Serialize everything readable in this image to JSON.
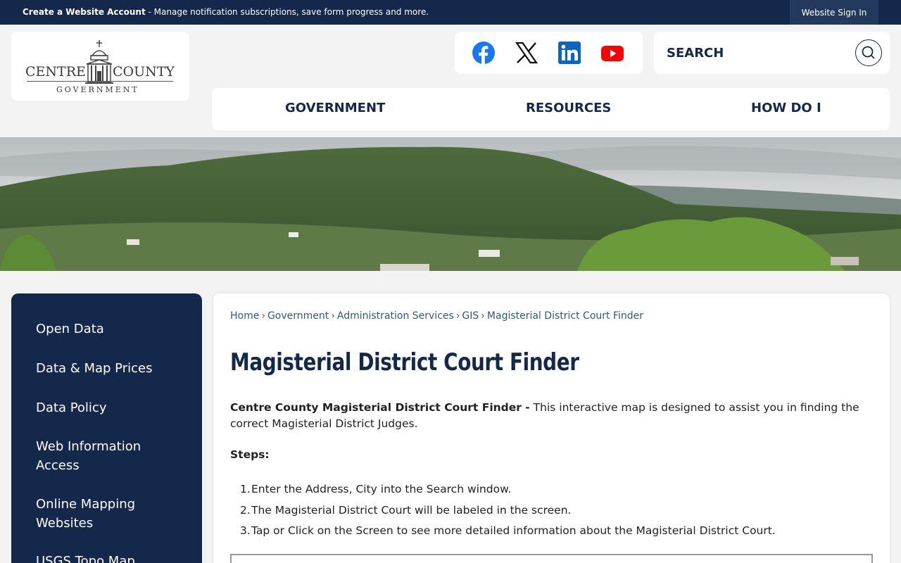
{
  "topbar": {
    "create_label": "Create a Website Account",
    "create_text": " - Manage notification subscriptions, save form progress and more.",
    "signin_label": "Website Sign In"
  },
  "logo": {
    "left_text": "CENTRE",
    "right_text": "COUNTY",
    "sub_text": "GOVERNMENT"
  },
  "social": {
    "facebook_icon": "facebook-icon",
    "x_icon": "x-icon",
    "linkedin_icon": "linkedin-icon",
    "youtube_icon": "youtube-icon"
  },
  "search": {
    "placeholder": "SEARCH",
    "icon": "search-icon"
  },
  "nav": {
    "items": [
      "GOVERNMENT",
      "RESOURCES",
      "HOW DO I"
    ]
  },
  "sidebar": {
    "items": [
      "Open Data",
      "Data & Map Prices",
      "Data Policy",
      "Web Information Access",
      "Online Mapping Websites",
      "USGS Topo Map"
    ]
  },
  "breadcrumb": {
    "items": [
      "Home",
      "Government",
      "Administration Services",
      "GIS",
      "Magisterial District Court Finder"
    ],
    "separator": "›"
  },
  "page": {
    "title": "Magisterial District Court Finder",
    "intro_bold": "Centre County Magisterial District Court Finder -",
    "intro_text": " This interactive map is designed to assist you in finding the correct Magisterial District Judges.",
    "steps_heading": "Steps:",
    "steps": [
      "Enter the Address, City into the Search window.",
      "The Magisterial District Court will be labeled in the screen.",
      "Tap or Click on the Screen to see more detailed information about the Magisterial District Court."
    ]
  },
  "colors": {
    "navy": "#13284a",
    "link": "#2e5a7a",
    "facebook": "#1877f2",
    "linkedin": "#0a66c2",
    "youtube": "#ff0000"
  }
}
